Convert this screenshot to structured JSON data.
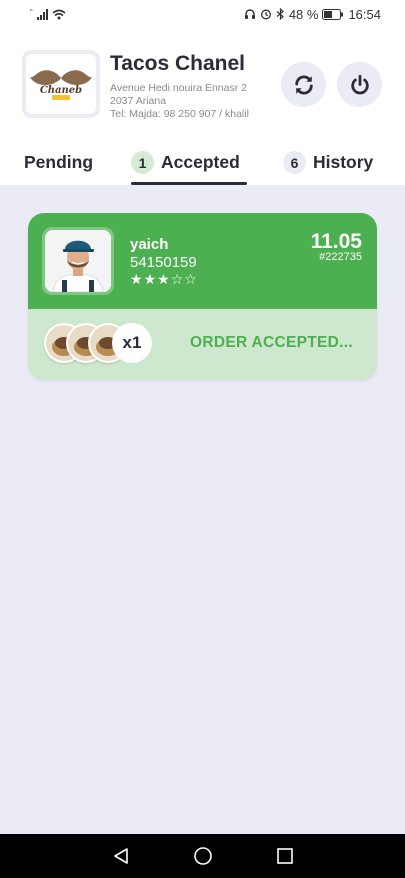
{
  "status_bar": {
    "battery": "48 %",
    "time": "16:54"
  },
  "shop": {
    "name": "Tacos Chanel",
    "address_line1": "Avenue Hedi nouira Ennasr 2",
    "address_line2": "2037 Ariana",
    "address_line3": "Tel: Majda: 98 250 907 / khalil",
    "logo_text": "Chaneb"
  },
  "header_buttons": {
    "refresh_icon": "refresh-icon",
    "power_icon": "power-icon"
  },
  "tabs": [
    {
      "label": "Pending",
      "count": ""
    },
    {
      "label": "Accepted",
      "count": "1"
    },
    {
      "label": "History",
      "count": "6"
    }
  ],
  "active_tab": "Accepted",
  "orders": [
    {
      "customer_name": "yaich",
      "phone": "54150159",
      "rating": 3,
      "rating_max": 5,
      "price": "11.05",
      "order_id": "#222735",
      "item_count": "x1",
      "status": "ORDER ACCEPTED...",
      "colors": {
        "header": "#4caf50",
        "footer": "#cde8ce",
        "status": "#4caf50"
      }
    }
  ],
  "colors": {
    "background": "#ebebf6",
    "accent_green": "#4caf50",
    "text_dark": "#2c2c37"
  }
}
